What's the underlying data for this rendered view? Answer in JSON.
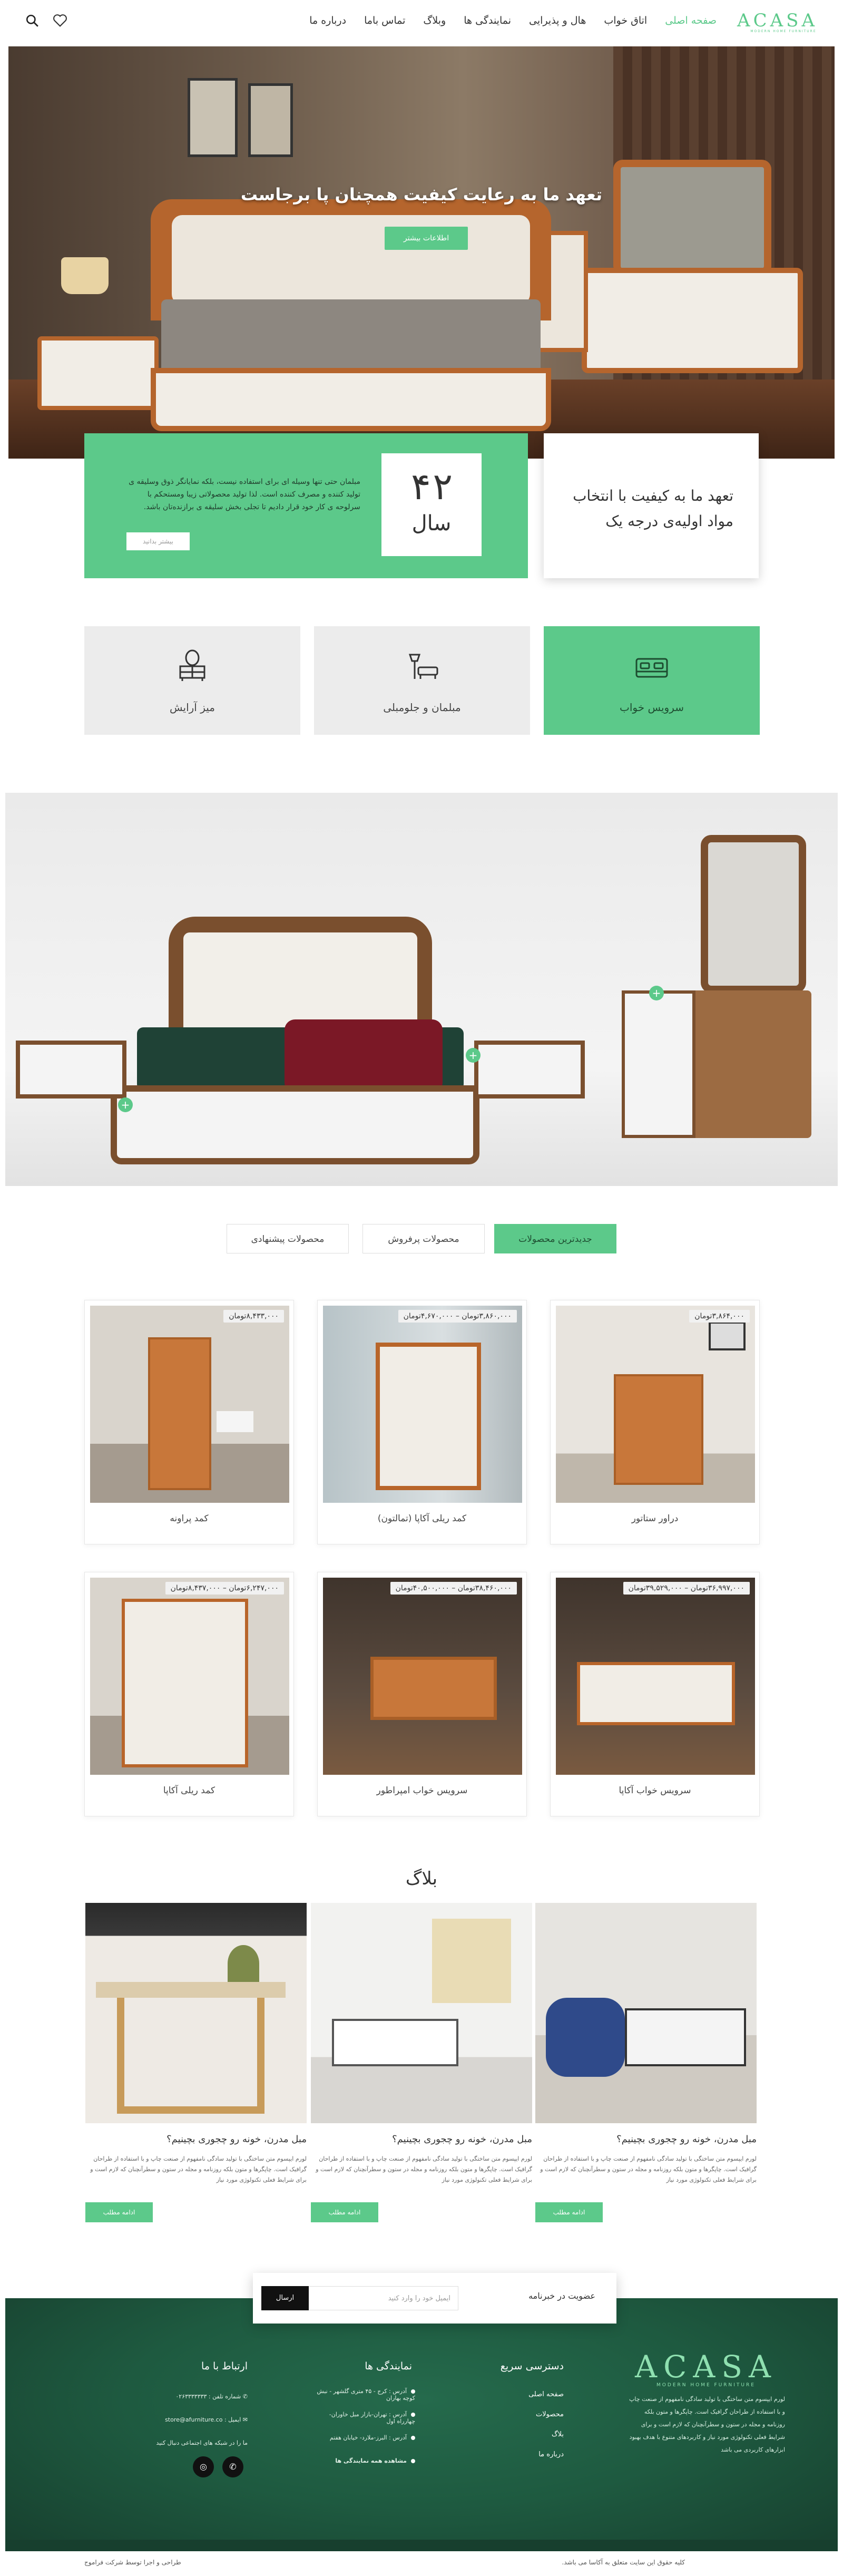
{
  "header": {
    "logo": "ACASA",
    "logo_sub": "MODERN HOME FURNITURE",
    "nav": [
      "صفحه اصلی",
      "اتاق خواب",
      "هال و پذیرایی",
      "نمایندگی ها",
      "وبلاگ",
      "تماس باما",
      "درباره ما"
    ],
    "icons": [
      "search-icon",
      "heart-icon"
    ]
  },
  "hero": {
    "title": "تعهد ما به رعایت کیفیت همچنان پا برجاست",
    "button": "اطلاعات بیشتر"
  },
  "intro": {
    "quality_text": "تعهد ما به کیفیت با انتخاب مواد اولیه‌ی درجه یک",
    "years_number": "۴۲",
    "years_unit": "سال",
    "description": "مبلمان حتی تنها وسیله ای برای استفاده نیست، بلکه نمایانگر ذوق وسلیقه ی تولید کننده و مصرف کننده است. لذا تولید محصولاتی زیبا ومستحکم با سرلوحه ی کار خود قرار دادیم تا تجلی بخش سلیقه ی برازنده‌تان باشد.",
    "more_button": "بیشتر بدانید"
  },
  "categories": [
    {
      "label": "سرویس خواب",
      "icon": "bed-icon"
    },
    {
      "label": "مبلمان و جلومبلی",
      "icon": "lamp-icon"
    },
    {
      "label": "میز آرایش",
      "icon": "vanity-icon"
    }
  ],
  "tabs": [
    "جدیدترین محصولات",
    "محصولات پرفروش",
    "محصولات پیشنهادی"
  ],
  "products": [
    {
      "name": "دراور ستاتور",
      "price": "۳,۸۶۴,۰۰۰تومان"
    },
    {
      "name": "کمد ریلی آکاپا (تمالتون)",
      "price": "۳,۸۶۰,۰۰۰تومان – ۴,۶۷۰,۰۰۰تومان"
    },
    {
      "name": "کمد پراونه",
      "price": "۸,۴۳۳,۰۰۰تومان"
    },
    {
      "name": "سرویس خواب آکاپا",
      "price": "۳۶,۹۹۷,۰۰۰تومان – ۳۹,۵۲۹,۰۰۰تومان"
    },
    {
      "name": "سرویس خواب امپراطور",
      "price": "۳۸,۴۶۰,۰۰۰تومان – ۴۰,۵۰۰,۰۰۰تومان"
    },
    {
      "name": "کمد ریلی آکاپا",
      "price": "۶,۲۴۷,۰۰۰تومان – ۸,۴۳۷,۰۰۰تومان"
    }
  ],
  "blog": {
    "title": "بلاگ",
    "posts": [
      {
        "title": "مبل مدرن، خونه رو چجوری بچینیم؟",
        "excerpt": "لورم ایپسوم متن ساختگی با تولید سادگی نامفهوم از صنعت چاپ و با استفاده از طراحان گرافیک است. چاپگرها و متون بلکه روزنامه و مجله در ستون و سطرآنچنان که لازم است و برای شرایط فعلی تکنولوژی مورد نیاز",
        "button": "ادامه مطلب"
      },
      {
        "title": "مبل مدرن، خونه رو چجوری بچینیم؟",
        "excerpt": "لورم ایپسوم متن ساختگی با تولید سادگی نامفهوم از صنعت چاپ و با استفاده از طراحان گرافیک است. چاپگرها و متون بلکه روزنامه و مجله در ستون و سطرآنچنان که لازم است و برای شرایط فعلی تکنولوژی مورد نیاز",
        "button": "ادامه مطلب"
      },
      {
        "title": "مبل مدرن، خونه رو چجوری بچینیم؟",
        "excerpt": "لورم ایپسوم متن ساختگی با تولید سادگی نامفهوم از صنعت چاپ و با استفاده از طراحان گرافیک است. چاپگرها و متون بلکه روزنامه و مجله در ستون و سطرآنچنان که لازم است و برای شرایط فعلی تکنولوژی مورد نیاز",
        "button": "ادامه مطلب"
      }
    ]
  },
  "newsletter": {
    "label": "عضویت در خبرنامه",
    "placeholder": "ایمیل خود را وارد کنید",
    "button": "ارسال"
  },
  "footer": {
    "logo": "ACASA",
    "logo_sub": "MODERN HOME FURNITURE",
    "about": "لورم ایپسوم متن ساختگی با تولید سادگی نامفهوم از صنعت چاپ و با استفاده از طراحان گرافیک است. چاپگرها و متون بلکه روزنامه و مجله در ستون و سطرآنچنان که لازم است و برای شرایط فعلی تکنولوژی مورد نیاز و کاربردهای متنوع با هدف بهبود ابزارهای کاربردی می باشد",
    "quick_title": "دسترسی سریع",
    "quick_links": [
      "صفحه اصلی",
      "محصولات",
      "بلاگ",
      "درباره ما"
    ],
    "agents_title": "نمایندگی ها",
    "agents": [
      "آدرس : کرج - ۴۵ متری گلشهر - نبش کوچه بهاران",
      "آدرس : تهران-بازار مبل خاوران-چهارراه اول",
      "آدرس : البرز-ملارد- خیابان هفتم",
      "مشاهده همه نمایندگی ها"
    ],
    "contact_title": "ارتباط با ما",
    "phone": "شماره تلفن : ۰۲۶۳۳۳۳۳۳۳",
    "email": "ایمیل : store@afurniture.co",
    "social_text": "ما را در شبکه های اجتماعی دنبال کنید",
    "copyright": "کلیه حقوق این سایت متعلق به آکاسا می باشد.",
    "designer": "طراحی و اجرا توسط شرکت فراموج"
  },
  "colors": {
    "accent": "#5cc98a",
    "footer": "#1e5a40"
  }
}
